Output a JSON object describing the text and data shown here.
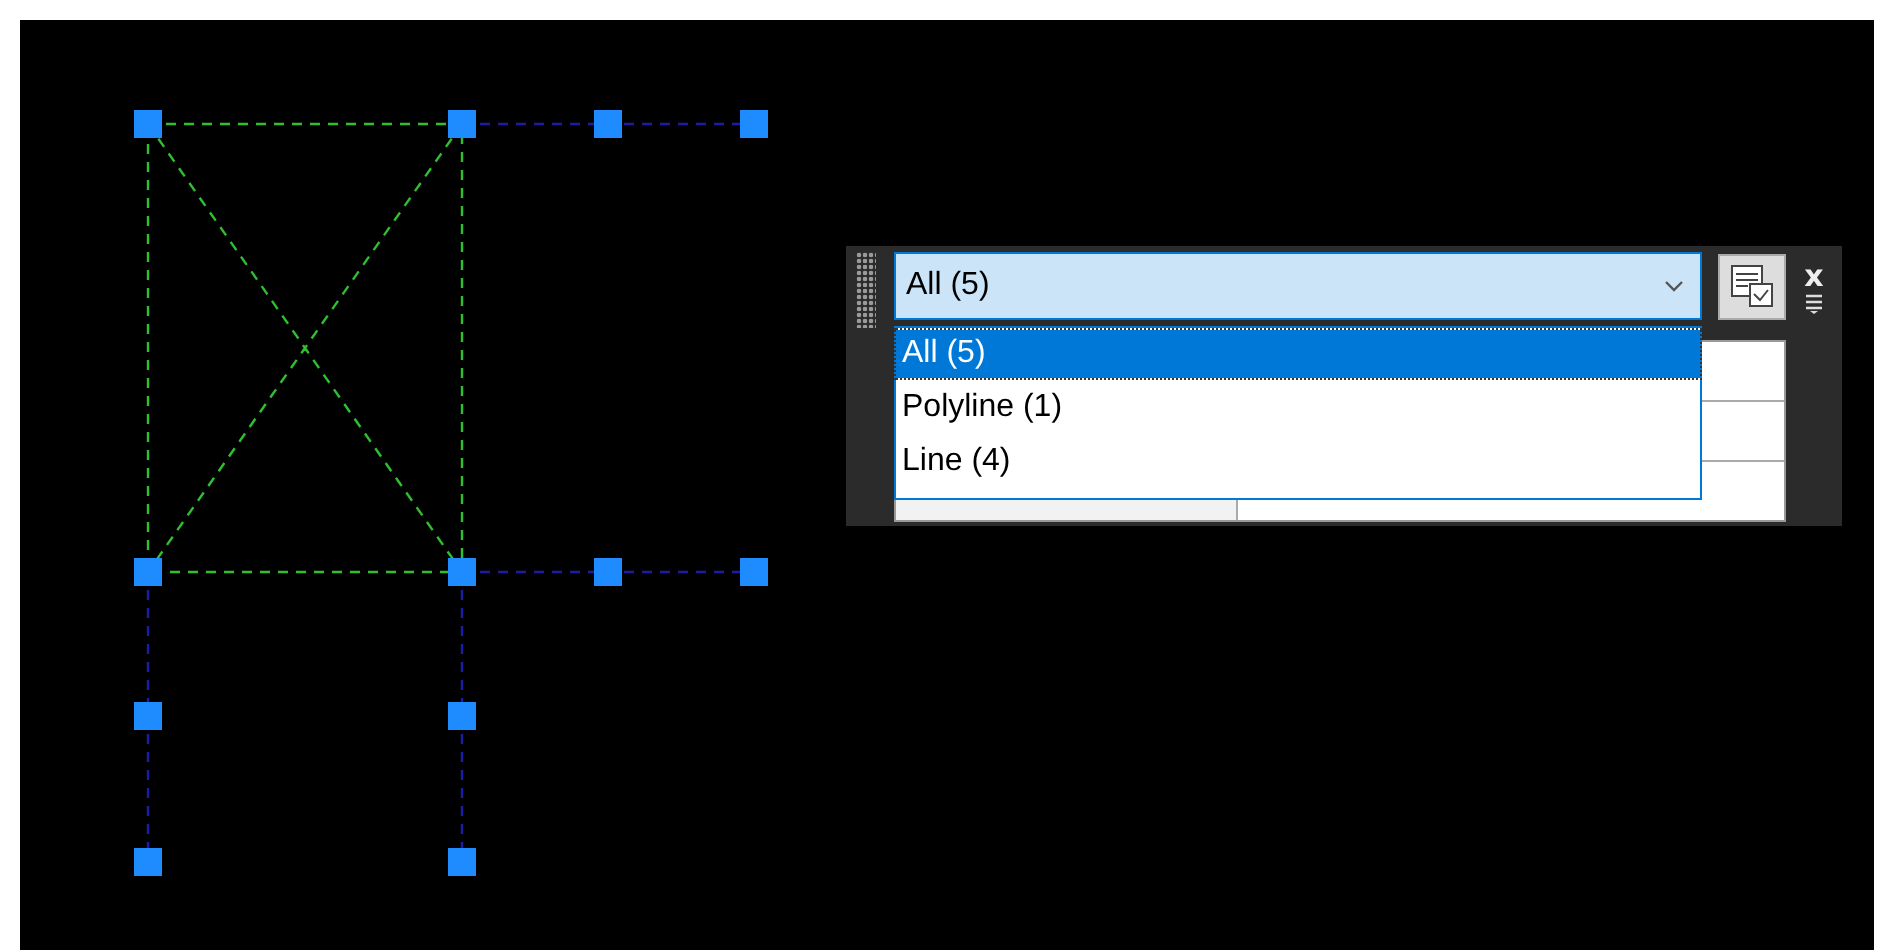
{
  "selection_filter": {
    "value": "All (5)",
    "expanded": true,
    "options": [
      {
        "label": "All (5)",
        "selected": true
      },
      {
        "label": "Polyline (1)",
        "selected": false
      },
      {
        "label": "Line (4)",
        "selected": false
      }
    ]
  },
  "close_button": "x"
}
